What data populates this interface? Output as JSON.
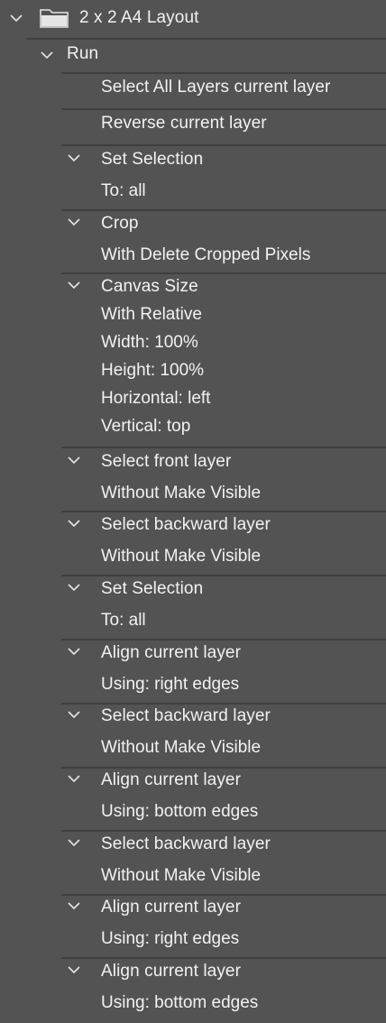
{
  "set": {
    "name": "2 x 2 A4 Layout",
    "action": "Run"
  },
  "steps": [
    {
      "title": "Select All Layers current layer",
      "details": []
    },
    {
      "title": "Reverse current layer",
      "details": []
    },
    {
      "title": "Set Selection",
      "details": [
        "To: all"
      ]
    },
    {
      "title": "Crop",
      "details": [
        "With Delete Cropped Pixels"
      ]
    },
    {
      "title": "Canvas Size",
      "details": [
        "With Relative",
        "Width: 100%",
        "Height: 100%",
        "Horizontal: left",
        "Vertical: top"
      ]
    },
    {
      "title": "Select front layer",
      "details": [
        "Without Make Visible"
      ]
    },
    {
      "title": "Select backward layer",
      "details": [
        "Without Make Visible"
      ]
    },
    {
      "title": "Set Selection",
      "details": [
        "To: all"
      ]
    },
    {
      "title": "Align current layer",
      "details": [
        "Using: right edges"
      ]
    },
    {
      "title": "Select backward layer",
      "details": [
        "Without Make Visible"
      ]
    },
    {
      "title": "Align current layer",
      "details": [
        "Using: bottom edges"
      ]
    },
    {
      "title": "Select backward layer",
      "details": [
        "Without Make Visible"
      ]
    },
    {
      "title": "Align current layer",
      "details": [
        "Using: right edges"
      ]
    },
    {
      "title": "Align current layer",
      "details": [
        "Using: bottom edges"
      ]
    }
  ]
}
